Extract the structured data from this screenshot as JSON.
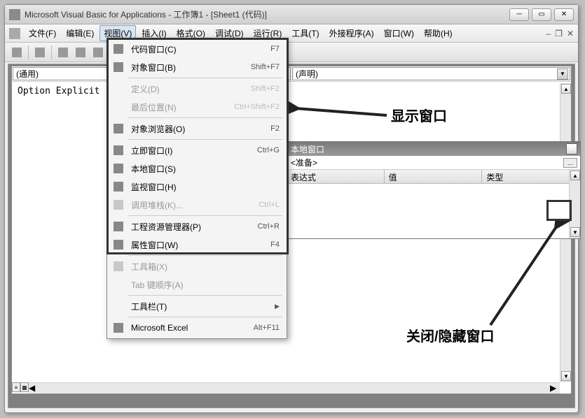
{
  "window": {
    "title": "Microsoft Visual Basic for Applications - 工作簿1 - [Sheet1 (代码)]"
  },
  "menubar": {
    "items": [
      {
        "label": "文件(F)"
      },
      {
        "label": "编辑(E)"
      },
      {
        "label": "视图(V)"
      },
      {
        "label": "插入(I)"
      },
      {
        "label": "格式(O)"
      },
      {
        "label": "调试(D)"
      },
      {
        "label": "运行(R)"
      },
      {
        "label": "工具(T)"
      },
      {
        "label": "外接程序(A)"
      },
      {
        "label": "窗口(W)"
      },
      {
        "label": "帮助(H)"
      }
    ]
  },
  "dropdown": {
    "items": [
      {
        "label": "代码窗口(C)",
        "shortcut": "F7",
        "icon": true
      },
      {
        "label": "对象窗口(B)",
        "shortcut": "Shift+F7",
        "icon": true
      },
      {
        "label": "定义(D)",
        "shortcut": "Shift+F2",
        "disabled": true
      },
      {
        "label": "最后位置(N)",
        "shortcut": "Ctrl+Shift+F2",
        "disabled": true
      },
      {
        "label": "对象浏览器(O)",
        "shortcut": "F2",
        "icon": true
      },
      {
        "label": "立即窗口(I)",
        "shortcut": "Ctrl+G",
        "icon": true
      },
      {
        "label": "本地窗口(S)",
        "shortcut": "",
        "icon": true
      },
      {
        "label": "监视窗口(H)",
        "shortcut": "",
        "icon": true
      },
      {
        "label": "调用堆栈(K)...",
        "shortcut": "Ctrl+L",
        "disabled": true,
        "icon": true
      },
      {
        "label": "工程资源管理器(P)",
        "shortcut": "Ctrl+R",
        "icon": true
      },
      {
        "label": "属性窗口(W)",
        "shortcut": "F4",
        "icon": true
      },
      {
        "label": "工具箱(X)",
        "shortcut": "",
        "disabled": true,
        "icon": true
      },
      {
        "label": "Tab 键顺序(A)",
        "shortcut": "",
        "disabled": true
      },
      {
        "label": "工具栏(T)",
        "shortcut": "",
        "submenu": true
      },
      {
        "label": "Microsoft Excel",
        "shortcut": "Alt+F11",
        "icon": true
      }
    ],
    "sep_after": [
      1,
      3,
      4,
      8,
      10,
      12,
      13
    ]
  },
  "code_window": {
    "left_dropdown": "(通用)",
    "right_dropdown": "(声明)",
    "code_line1": "Option Explicit"
  },
  "locals_window": {
    "title": "本地窗口",
    "status": "<准备>",
    "columns": [
      "表达式",
      "值",
      "类型"
    ]
  },
  "annotations": {
    "show_window": "显示窗口",
    "close_window": "关闭/隐藏窗口"
  }
}
